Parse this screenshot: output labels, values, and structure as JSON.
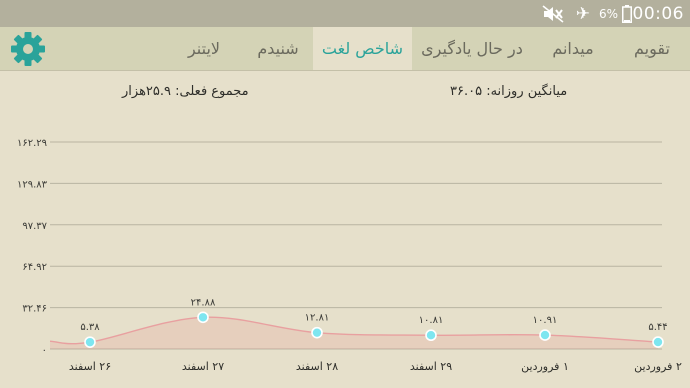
{
  "status_bar": {
    "battery": "6%",
    "time": "00:06",
    "icons": [
      "mute-icon",
      "airplane-icon",
      "battery-icon"
    ]
  },
  "tabs": [
    {
      "label": "تقویم",
      "active": false
    },
    {
      "label": "میدانم",
      "active": false
    },
    {
      "label": "در حال یادگیری",
      "active": false
    },
    {
      "label": "شاخص لغت",
      "active": true
    },
    {
      "label": "شنیدم",
      "active": false
    },
    {
      "label": "لایتنر",
      "active": false
    }
  ],
  "summary": {
    "daily_average": "میانگین روزانه: ۳۶.۰۵",
    "total": "مجموع فعلی: ۲۵.۹هزار"
  },
  "colors": {
    "accent": "#2aa39a",
    "background": "#e6e0cb",
    "tabbar": "#d4d3b6",
    "statusbar": "#b3b09d",
    "line": "#e8a0a0",
    "point": "#7ee6f0"
  },
  "chart_data": {
    "type": "line",
    "categories": [
      "۲۶ اسفند",
      "۲۷ اسفند",
      "۲۸ اسفند",
      "۲۹ اسفند",
      "۱ فروردین",
      "۲ فروردین"
    ],
    "values": [
      5.38,
      24.88,
      12.81,
      10.81,
      10.91,
      5.44
    ],
    "value_labels": [
      "۵.۳۸",
      "۲۴.۸۸",
      "۱۲.۸۱",
      "۱۰.۸۱",
      "۱۰.۹۱",
      "۵.۴۴"
    ],
    "y_ticks": [
      0,
      32.46,
      64.92,
      97.37,
      129.83,
      162.29
    ],
    "y_tick_labels": [
      "۰",
      "۳۲.۴۶",
      "۶۴.۹۲",
      "۹۷.۳۷",
      "۱۲۹.۸۳",
      "۱۶۲.۲۹"
    ],
    "ylim": [
      0,
      162.29
    ],
    "grid": true,
    "area_fill": true,
    "smooth": true
  }
}
